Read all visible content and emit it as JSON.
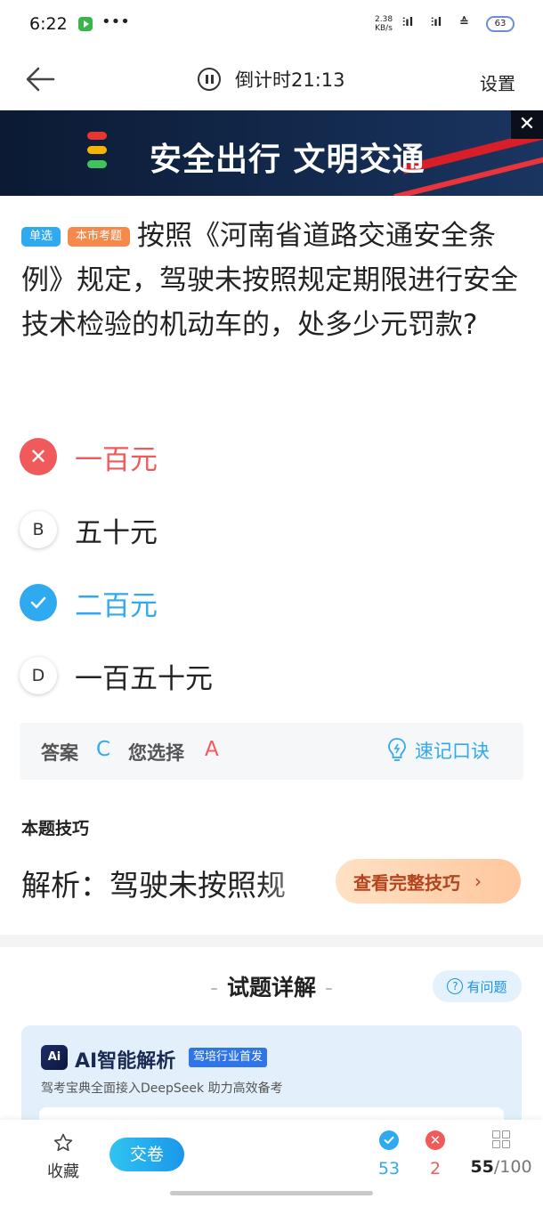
{
  "status_bar": {
    "time": "6:22",
    "more": "•••",
    "speed_value": "2.38",
    "speed_unit": "KB/s",
    "battery": "63"
  },
  "header": {
    "timer": "倒计时21:13",
    "settings_label": "设置"
  },
  "banner": {
    "text": "安全出行 文明交通",
    "close": "✕"
  },
  "question": {
    "type_tag": "单选",
    "source_tag": "本市考题",
    "text": "按照《河南省道路交通安全条例》规定，驾驶未按照规定期限进行安全技术检验的机动车的，处多少元罚款?"
  },
  "options": [
    {
      "key": "A",
      "marker": "✕",
      "text": "一百元",
      "state": "wrong",
      "color": "#f05a5a"
    },
    {
      "key": "B",
      "marker": "B",
      "text": "五十元",
      "state": "normal",
      "color": "#222222"
    },
    {
      "key": "C",
      "marker": "",
      "text": "二百元",
      "state": "correct",
      "color": "#2fa9f0"
    },
    {
      "key": "D",
      "marker": "D",
      "text": "一百五十元",
      "state": "normal",
      "color": "#222222"
    }
  ],
  "answer": {
    "answer_label": "答案",
    "correct_value": "C",
    "selected_label": "您选择",
    "selected_value": "A",
    "mnemonic_label": "速记口诀"
  },
  "tip": {
    "title": "本题技巧",
    "text": "解析：驾驶未按照规",
    "button_label": "查看完整技巧"
  },
  "details": {
    "title": "试题详解",
    "dash": "-",
    "question_button": "有问题",
    "ai_logo": "Ai",
    "ai_title": "AI智能解析",
    "ai_badge": "驾培行业首发",
    "ai_subtitle": "驾考宝典全面接入DeepSeek 助力高效备考"
  },
  "bottom_bar": {
    "favorite_label": "收藏",
    "submit_label": "交卷",
    "correct_count": "53",
    "wrong_count": "2",
    "progress_current": "55",
    "progress_total": "/100"
  },
  "colors": {
    "accent": "#2fa9f0",
    "wrong": "#f05a5a",
    "tip_button": "#ffc79e"
  }
}
